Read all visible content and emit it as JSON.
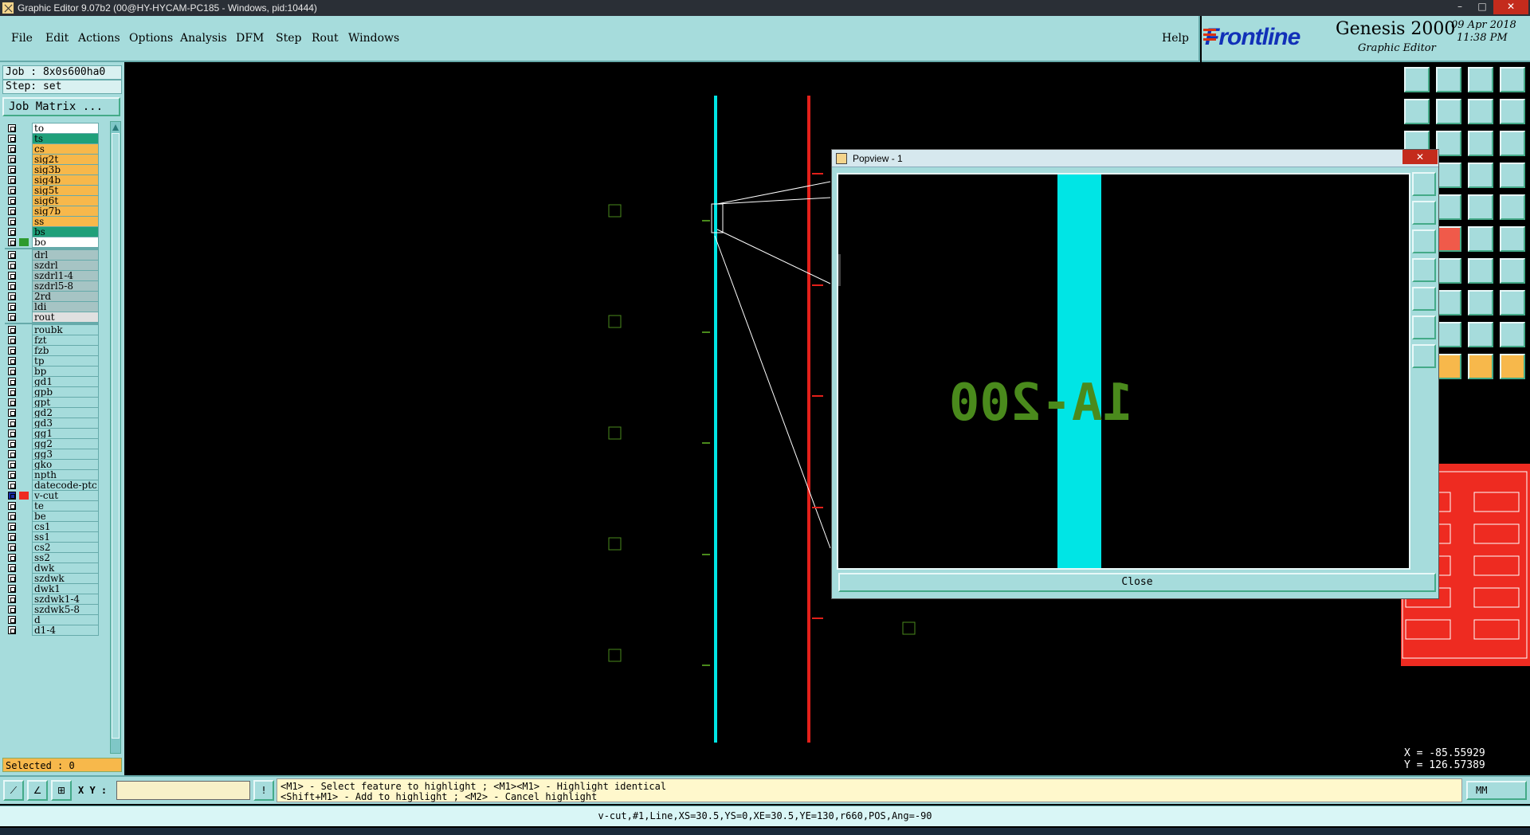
{
  "window": {
    "title": "Graphic Editor 9.07b2 (00@HY-HYCAM-PC185 - Windows, pid:10444)",
    "minimize": "–",
    "maximize": "□",
    "close": "✕"
  },
  "menu": {
    "items": [
      "File",
      "Edit",
      "Actions",
      "Options",
      "Analysis",
      "DFM",
      "Step",
      "Rout",
      "Windows"
    ],
    "help": "Help"
  },
  "logo": {
    "brand": "Frontline",
    "product": "Genesis 2000",
    "subtitle": "Graphic Editor",
    "date": "09 Apr 2018",
    "time": "11:38 PM"
  },
  "job": {
    "job_line": "Job : 8x0s600ha0",
    "step_line": "Step: set",
    "matrix_button": "Job Matrix ...",
    "selected": "Selected : 0"
  },
  "layers": [
    {
      "name": "to",
      "color": "#ffffff",
      "swatch": ""
    },
    {
      "name": "ts",
      "color": "#1fa07a",
      "swatch": ""
    },
    {
      "name": "cs",
      "color": "#f7b84b",
      "swatch": ""
    },
    {
      "name": "sig2t",
      "color": "#f7b84b",
      "swatch": ""
    },
    {
      "name": "sig3b",
      "color": "#f7b84b",
      "swatch": ""
    },
    {
      "name": "sig4b",
      "color": "#f7b84b",
      "swatch": ""
    },
    {
      "name": "sig5t",
      "color": "#f7b84b",
      "swatch": ""
    },
    {
      "name": "sig6t",
      "color": "#f7b84b",
      "swatch": ""
    },
    {
      "name": "sig7b",
      "color": "#f7b84b",
      "swatch": ""
    },
    {
      "name": "ss",
      "color": "#f7b84b",
      "swatch": ""
    },
    {
      "name": "bs",
      "color": "#1fa07a",
      "swatch": ""
    },
    {
      "name": "bo",
      "color": "#ffffff",
      "swatch": "#2e9a2e"
    },
    {
      "name": "drl",
      "color": "#a6c4c4",
      "swatch": "",
      "sep": true
    },
    {
      "name": "szdrl",
      "color": "#a6c4c4",
      "swatch": ""
    },
    {
      "name": "szdrl1-4",
      "color": "#a6c4c4",
      "swatch": ""
    },
    {
      "name": "szdrl5-8",
      "color": "#a6c4c4",
      "swatch": ""
    },
    {
      "name": "2rd",
      "color": "#a6c4c4",
      "swatch": ""
    },
    {
      "name": "ldi",
      "color": "#a6c4c4",
      "swatch": ""
    },
    {
      "name": "rout",
      "color": "#e0e0e0",
      "swatch": ""
    },
    {
      "name": "roubk",
      "color": "#a6dcdc",
      "swatch": "",
      "sep": true
    },
    {
      "name": "fzt",
      "color": "#a6dcdc",
      "swatch": ""
    },
    {
      "name": "fzb",
      "color": "#a6dcdc",
      "swatch": ""
    },
    {
      "name": "tp",
      "color": "#a6dcdc",
      "swatch": ""
    },
    {
      "name": "bp",
      "color": "#a6dcdc",
      "swatch": ""
    },
    {
      "name": "gd1",
      "color": "#a6dcdc",
      "swatch": ""
    },
    {
      "name": "gpb",
      "color": "#a6dcdc",
      "swatch": ""
    },
    {
      "name": "gpt",
      "color": "#a6dcdc",
      "swatch": ""
    },
    {
      "name": "gd2",
      "color": "#a6dcdc",
      "swatch": ""
    },
    {
      "name": "gd3",
      "color": "#a6dcdc",
      "swatch": ""
    },
    {
      "name": "gg1",
      "color": "#a6dcdc",
      "swatch": ""
    },
    {
      "name": "gg2",
      "color": "#a6dcdc",
      "swatch": ""
    },
    {
      "name": "gg3",
      "color": "#a6dcdc",
      "swatch": ""
    },
    {
      "name": "gko",
      "color": "#a6dcdc",
      "swatch": ""
    },
    {
      "name": "npth",
      "color": "#a6dcdc",
      "swatch": ""
    },
    {
      "name": "datecode-ptc",
      "color": "#a6dcdc",
      "swatch": ""
    },
    {
      "name": "v-cut",
      "color": "#a6dcdc",
      "swatch": "#ee2b21",
      "selected": true
    },
    {
      "name": "te",
      "color": "#a6dcdc",
      "swatch": ""
    },
    {
      "name": "be",
      "color": "#a6dcdc",
      "swatch": ""
    },
    {
      "name": "cs1",
      "color": "#a6dcdc",
      "swatch": ""
    },
    {
      "name": "ss1",
      "color": "#a6dcdc",
      "swatch": ""
    },
    {
      "name": "cs2",
      "color": "#a6dcdc",
      "swatch": ""
    },
    {
      "name": "ss2",
      "color": "#a6dcdc",
      "swatch": ""
    },
    {
      "name": "dwk",
      "color": "#a6dcdc",
      "swatch": ""
    },
    {
      "name": "szdwk",
      "color": "#a6dcdc",
      "swatch": ""
    },
    {
      "name": "dwk1",
      "color": "#a6dcdc",
      "swatch": ""
    },
    {
      "name": "szdwk1-4",
      "color": "#a6dcdc",
      "swatch": ""
    },
    {
      "name": "szdwk5-8",
      "color": "#a6dcdc",
      "swatch": ""
    },
    {
      "name": "d",
      "color": "#a6dcdc",
      "swatch": ""
    },
    {
      "name": "d1-4",
      "color": "#a6dcdc",
      "swatch": ""
    }
  ],
  "popview": {
    "title": "Popview - 1",
    "close_label": "Close",
    "mirrored_text": "1A-200"
  },
  "coords": {
    "x": "X = -85.55929",
    "y": "Y = 126.57389",
    "unit": "mm"
  },
  "bottom": {
    "xy_label": "X Y :",
    "xy_value": "",
    "hint_line1": "<M1> - Select feature to highlight ; <M1><M1> - Highlight identical",
    "hint_line2": "<Shift+M1> - Add to highlight ; <M2> - Cancel highlight",
    "units": "MM",
    "status": "v-cut,#1,Line,XS=30.5,YS=0,XE=30.5,YE=130,r660,POS,Ang=-90"
  },
  "colors": {
    "panel": "#a6dcdc",
    "cyan_line": "#00e5e5",
    "red_line": "#e3201a",
    "feature_green": "#4a8a1c"
  }
}
